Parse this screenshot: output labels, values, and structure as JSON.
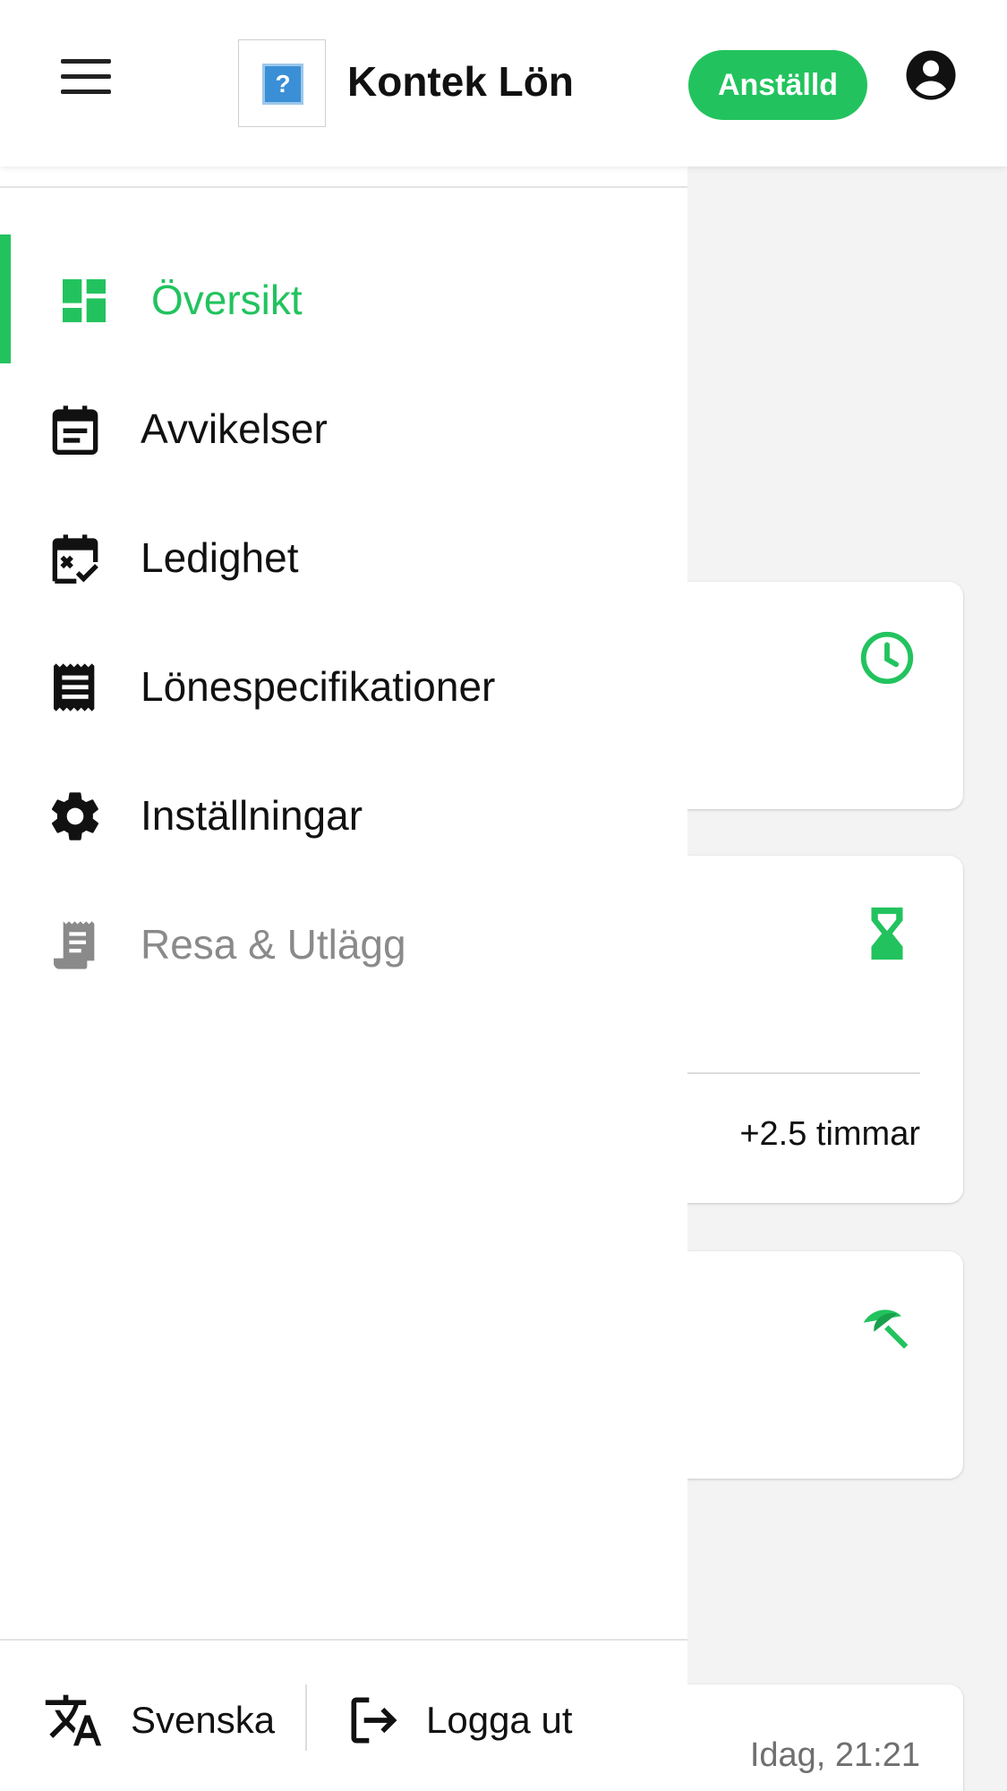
{
  "header": {
    "app_title": "Kontek Lön",
    "status_badge": "Anställd",
    "logo_glyph": "?"
  },
  "drawer": {
    "items": [
      {
        "label": "Översikt",
        "icon": "dashboard-icon",
        "active": true
      },
      {
        "label": "Avvikelser",
        "icon": "calendar-note-icon",
        "active": false
      },
      {
        "label": "Ledighet",
        "icon": "calendar-check-icon",
        "active": false
      },
      {
        "label": "Lönespecifikationer",
        "icon": "receipt-icon",
        "active": false
      },
      {
        "label": "Inställningar",
        "icon": "gear-icon",
        "active": false
      },
      {
        "label": "Resa & Utlägg",
        "icon": "receipt-long-icon",
        "active": false,
        "disabled": true
      }
    ],
    "footer": {
      "language_label": "Svenska",
      "logout_label": "Logga ut"
    }
  },
  "background": {
    "hours_value": "+2.5 timmar",
    "latest_time": "Idag, 21:21"
  },
  "colors": {
    "accent": "#22c35e",
    "text": "#111111",
    "muted": "#8a8a8a",
    "background": "#f3f3f3"
  }
}
